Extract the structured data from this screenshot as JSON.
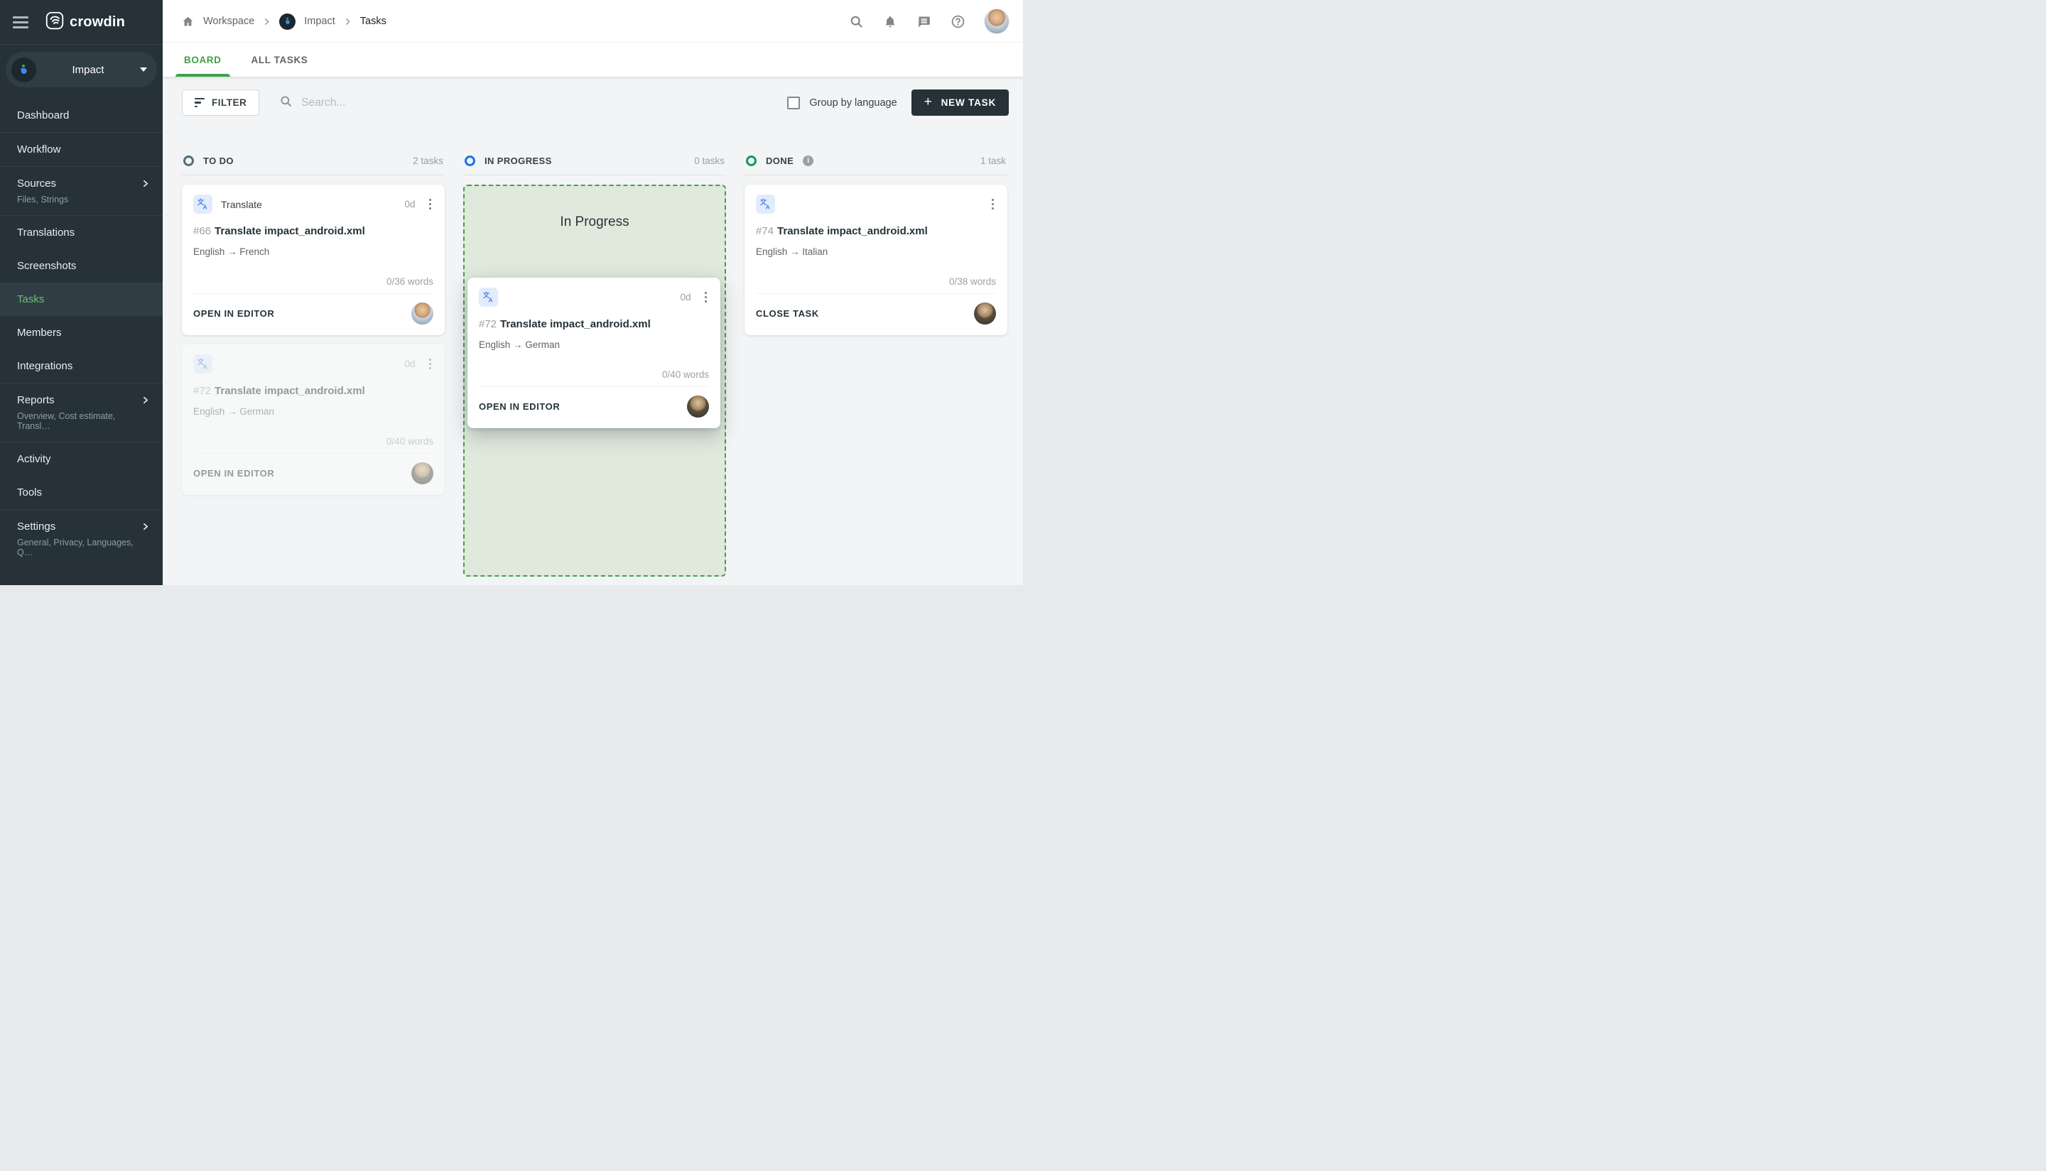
{
  "brand": {
    "name": "crowdin"
  },
  "sidebar": {
    "project": {
      "name": "Impact"
    },
    "items": [
      {
        "label": "Dashboard"
      },
      {
        "label": "Workflow"
      },
      {
        "label": "Sources",
        "subtitle": "Files, Strings"
      },
      {
        "label": "Translations"
      },
      {
        "label": "Screenshots"
      },
      {
        "label": "Tasks",
        "active": true
      },
      {
        "label": "Members"
      },
      {
        "label": "Integrations"
      },
      {
        "label": "Reports",
        "subtitle": "Overview, Cost estimate, Transl…"
      },
      {
        "label": "Activity"
      },
      {
        "label": "Tools"
      },
      {
        "label": "Settings",
        "subtitle": "General, Privacy, Languages, Q…"
      }
    ]
  },
  "breadcrumb": {
    "workspace": "Workspace",
    "project": "Impact",
    "current": "Tasks"
  },
  "tabs": {
    "board": "BOARD",
    "all_tasks": "ALL TASKS"
  },
  "toolbar": {
    "filter_label": "FILTER",
    "search_placeholder": "Search...",
    "group_by_label": "Group by language",
    "new_task_label": "NEW TASK",
    "new_task_plus": "+"
  },
  "board": {
    "columns": {
      "todo": {
        "label": "TO DO",
        "count": "2 tasks"
      },
      "in_progress": {
        "label": "IN PROGRESS",
        "count": "0 tasks",
        "dropzone_label": "In Progress"
      },
      "done": {
        "label": "DONE",
        "count": "1 task",
        "info": "i"
      }
    },
    "cards": {
      "card66": {
        "type_label": "Translate",
        "due": "0d",
        "id": "#66",
        "title": "Translate impact_android.xml",
        "languages": "English → French",
        "words": "0/36 words",
        "action": "OPEN IN EDITOR"
      },
      "card72_ghost": {
        "due": "0d",
        "id": "#72",
        "title": "Translate impact_android.xml",
        "languages": "English → German",
        "words": "0/40 words",
        "action": "OPEN IN EDITOR"
      },
      "card72_drag": {
        "due": "0d",
        "id": "#72",
        "title": "Translate impact_android.xml",
        "languages": "English → German",
        "words": "0/40 words",
        "action": "OPEN IN EDITOR"
      },
      "card74": {
        "id": "#74",
        "title": "Translate impact_android.xml",
        "languages": "English → Italian",
        "words": "0/38 words",
        "action": "CLOSE TASK"
      }
    }
  },
  "colors": {
    "accent_green": "#43a047",
    "sidebar_bg": "#263238",
    "sidebar_active_green": "#6cbf73",
    "todo_ring": "#546e7a",
    "progress_ring": "#1a73e8",
    "done_ring": "#0f9d58",
    "dropzone_bg": "#dfe9dc",
    "dropzone_border": "#43a047",
    "translate_icon_blue": "#4d86e8",
    "new_task_button_bg": "#263238",
    "board_bg": "#f2f4f5"
  }
}
